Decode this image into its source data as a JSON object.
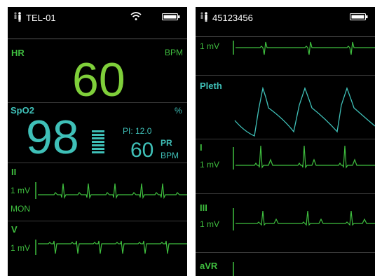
{
  "left": {
    "status": {
      "device_id": "TEL-01",
      "icons": [
        "person-icon",
        "wifi-icon",
        "battery-icon"
      ]
    },
    "hr": {
      "label": "HR",
      "unit": "BPM",
      "value": "60"
    },
    "spo2": {
      "label": "SpO2",
      "unit": "%",
      "value": "98",
      "pi_text": "PI: 12.0",
      "pr_label": "PR",
      "pr_unit": "BPM",
      "pr_value": "60"
    },
    "lead_ii": {
      "label": "II",
      "scale": "1 mV",
      "mode": "MON"
    },
    "lead_v": {
      "label": "V",
      "scale": "1 mV"
    }
  },
  "right": {
    "status": {
      "patient_id": "45123456",
      "icons": [
        "person-icon",
        "battery-icon"
      ]
    },
    "trace1": {
      "scale": "1 mV"
    },
    "pleth": {
      "label": "Pleth"
    },
    "lead_i": {
      "label": "I",
      "scale": "1 mV"
    },
    "lead_iii": {
      "label": "III",
      "scale": "1 mV"
    },
    "lead_avr": {
      "label": "aVR"
    }
  },
  "colors": {
    "ecg": "#3fbf3f",
    "hr": "#7fcf3a",
    "spo2": "#3fc0b8",
    "background": "#000000"
  }
}
